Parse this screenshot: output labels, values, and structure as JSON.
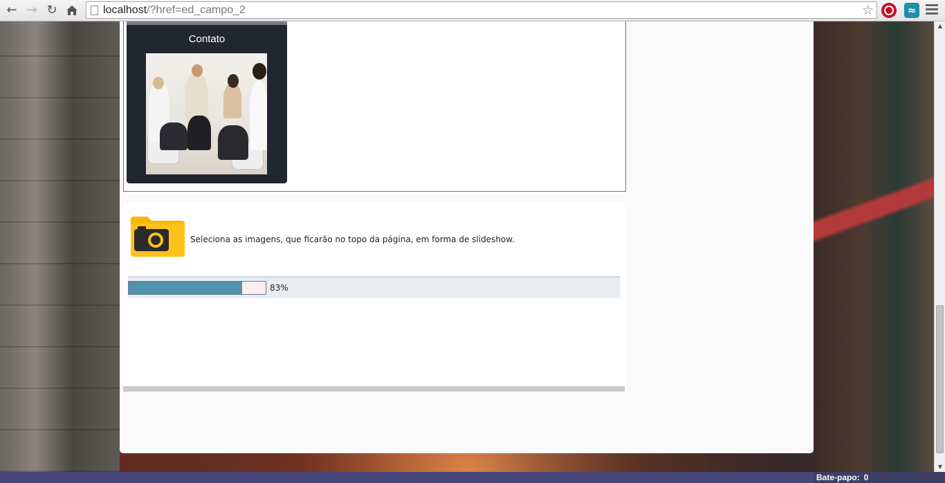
{
  "browser": {
    "url_host": "localhost",
    "url_path": "/?href=ed_campo_2"
  },
  "contact_panel": {
    "title": "Contato",
    "photo_desc": "group-meeting-photo"
  },
  "upload": {
    "description": "Seleciona as imagens, que ficarão no topo da página, em forma de slideshow.",
    "progress_value": 83,
    "progress_label": "83%",
    "icon": "camera-folder-icon"
  },
  "chat": {
    "label": "Bate-papo:",
    "count": "0"
  },
  "colors": {
    "progress_fill": "#4f93ad",
    "panel_bg": "#222630",
    "bottom_bar": "#46467a",
    "folder": "#f5b800"
  }
}
